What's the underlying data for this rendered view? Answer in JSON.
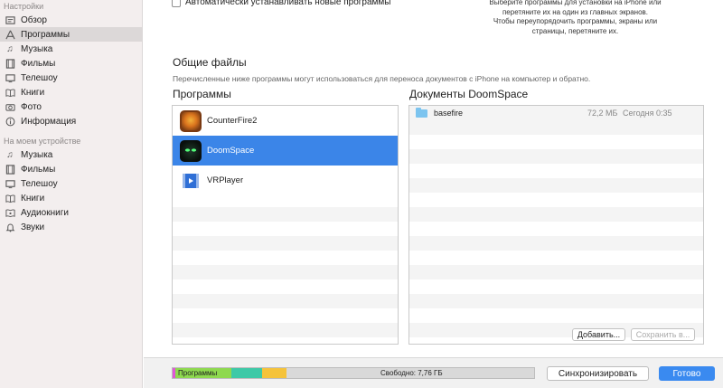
{
  "sidebar": {
    "section1_title": "Настройки",
    "section1_items": [
      {
        "label": "Обзор",
        "icon": "summary-icon"
      },
      {
        "label": "Программы",
        "icon": "apps-icon",
        "active": true
      },
      {
        "label": "Музыка",
        "icon": "music-icon"
      },
      {
        "label": "Фильмы",
        "icon": "film-icon"
      },
      {
        "label": "Телешоу",
        "icon": "tv-icon"
      },
      {
        "label": "Книги",
        "icon": "book-icon"
      },
      {
        "label": "Фото",
        "icon": "camera-icon"
      },
      {
        "label": "Информация",
        "icon": "info-icon"
      }
    ],
    "section2_title": "На моем устройстве",
    "section2_items": [
      {
        "label": "Музыка",
        "icon": "music-icon"
      },
      {
        "label": "Фильмы",
        "icon": "film-icon"
      },
      {
        "label": "Телешоу",
        "icon": "tv-icon"
      },
      {
        "label": "Книги",
        "icon": "book-icon"
      },
      {
        "label": "Аудиокниги",
        "icon": "audiobook-icon"
      },
      {
        "label": "Звуки",
        "icon": "bell-icon"
      }
    ]
  },
  "main": {
    "auto_install_label": "Автоматически устанавливать новые программы",
    "hint_lines": [
      "Выберите программы для установки на iPhone или",
      "перетяните их на один из главных экранов.",
      "Чтобы переупорядочить программы, экраны или",
      "страницы, перетяните их."
    ],
    "shared_files_title": "Общие файлы",
    "shared_files_desc": "Перечисленные ниже программы могут использоваться для переноса документов с iPhone на компьютер и обратно.",
    "apps_column_title": "Программы",
    "docs_column_title": "Документы DoomSpace",
    "apps": [
      {
        "name": "CounterFire2",
        "icon": "counterfire-app-icon"
      },
      {
        "name": "DoomSpace",
        "icon": "doomspace-app-icon",
        "selected": true
      },
      {
        "name": "VRPlayer",
        "icon": "vrplayer-app-icon"
      }
    ],
    "documents": [
      {
        "name": "basefire",
        "size": "72,2 МБ",
        "date": "Сегодня 0:35"
      }
    ],
    "add_button": "Добавить...",
    "save_button": "Сохранить в..."
  },
  "bottom": {
    "storage_apps_label": "Программы",
    "storage_free_label": "Свободно: 7,76 ГБ",
    "sync_button": "Синхронизировать",
    "done_button": "Готово"
  },
  "colors": {
    "accent": "#3b85e8",
    "storage_apps": "#8ed94f",
    "storage_teal": "#3ec9a7",
    "storage_yellow": "#f5c33b",
    "storage_pink": "#e055d8",
    "storage_free": "#d9d9d9"
  }
}
